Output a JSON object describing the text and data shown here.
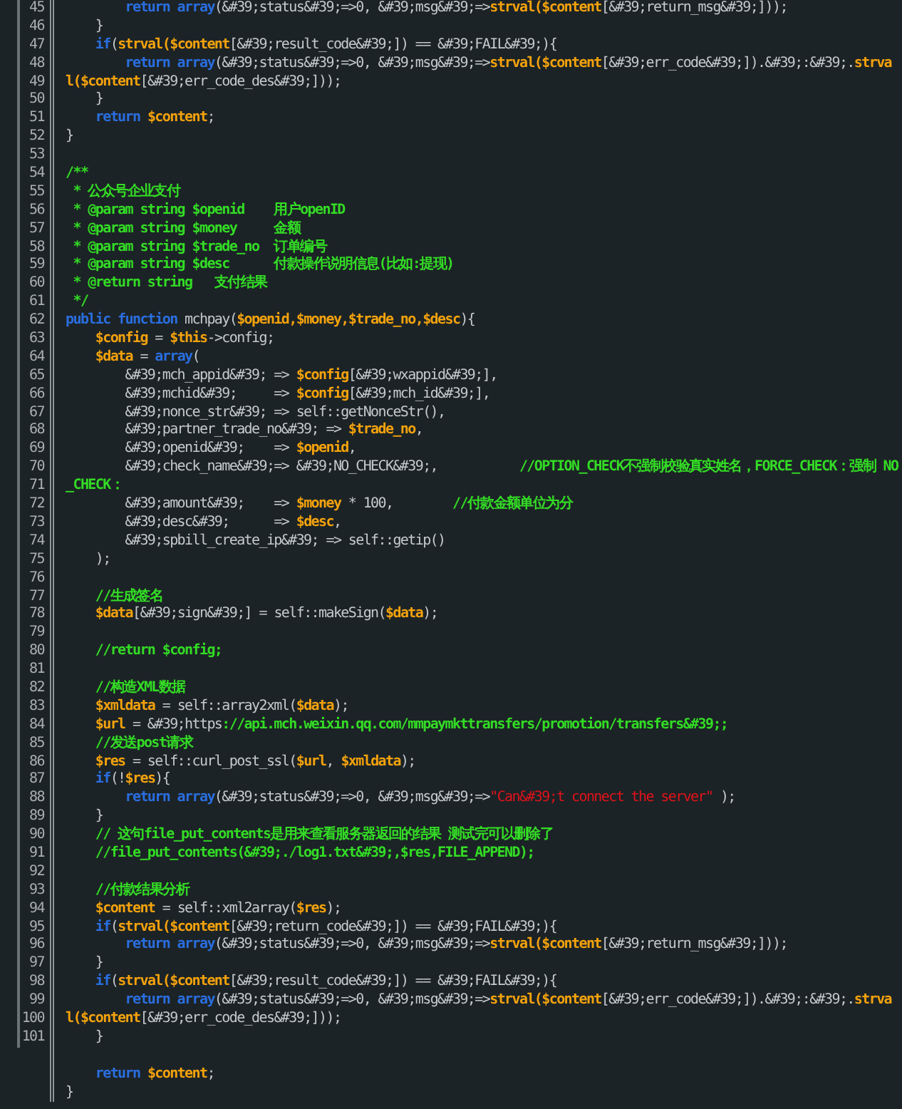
{
  "editor": {
    "lines": [
      {
        "number": "45",
        "tokens": [
          {
            "kind": "keyword",
            "text": "        return array"
          },
          {
            "kind": "plain",
            "text": "(&#39;status&#39;=>0, &#39;msg&#39;=>"
          },
          {
            "kind": "variable",
            "text": "strval($content"
          },
          {
            "kind": "plain",
            "text": "[&#39;return_msg&#39;]));"
          }
        ]
      },
      {
        "number": "46",
        "tokens": [
          {
            "kind": "plain",
            "text": "    }"
          }
        ]
      },
      {
        "number": "47",
        "tokens": [
          {
            "kind": "keyword",
            "text": "    if"
          },
          {
            "kind": "plain",
            "text": "("
          },
          {
            "kind": "variable",
            "text": "strval($content"
          },
          {
            "kind": "plain",
            "text": "[&#39;result_code&#39;]) == &#39;FAIL&#39;){"
          }
        ]
      },
      {
        "number": "48",
        "tokens": [
          {
            "kind": "keyword",
            "text": "        return array"
          },
          {
            "kind": "plain",
            "text": "(&#39;status&#39;=>0, &#39;msg&#39;=>"
          },
          {
            "kind": "variable",
            "text": "strval($content"
          },
          {
            "kind": "plain",
            "text": "[&#39;err_code&#39;]).&#39;:&#39;."
          },
          {
            "kind": "variable",
            "text": "strva"
          }
        ]
      },
      {
        "number": "49",
        "tokens": [
          {
            "kind": "variable",
            "text": "l($content"
          },
          {
            "kind": "plain",
            "text": "[&#39;err_code_des&#39;]));"
          }
        ]
      },
      {
        "number": "50",
        "tokens": [
          {
            "kind": "plain",
            "text": "    }"
          }
        ]
      },
      {
        "number": "51",
        "tokens": [
          {
            "kind": "keyword",
            "text": "    return"
          },
          {
            "kind": "variable",
            "text": " $content"
          },
          {
            "kind": "plain",
            "text": ";"
          }
        ]
      },
      {
        "number": "52",
        "tokens": [
          {
            "kind": "plain",
            "text": "}"
          }
        ]
      },
      {
        "number": "53"
      },
      {
        "number": "54",
        "tokens": [
          {
            "kind": "comment",
            "text": "/**"
          }
        ]
      },
      {
        "number": "55",
        "tokens": [
          {
            "kind": "comment",
            "text": " * 公众号企业支付"
          }
        ]
      },
      {
        "number": "56",
        "tokens": [
          {
            "kind": "comment",
            "text": " * @param string $openid    用户openID"
          }
        ]
      },
      {
        "number": "57",
        "tokens": [
          {
            "kind": "comment",
            "text": " * @param string $money     金额"
          }
        ]
      },
      {
        "number": "58",
        "tokens": [
          {
            "kind": "comment",
            "text": " * @param string $trade_no  订单编号"
          }
        ]
      },
      {
        "number": "59",
        "tokens": [
          {
            "kind": "comment",
            "text": " * @param string $desc      付款操作说明信息(比如:提现)"
          }
        ]
      },
      {
        "number": "60",
        "tokens": [
          {
            "kind": "comment",
            "text": " * @return string   支付结果"
          }
        ]
      },
      {
        "number": "61",
        "tokens": [
          {
            "kind": "comment",
            "text": " */"
          }
        ]
      },
      {
        "number": "62",
        "tokens": [
          {
            "kind": "keyword",
            "text": "public function"
          },
          {
            "kind": "plain",
            "text": " mchpay("
          },
          {
            "kind": "variable",
            "text": "$openid,$money,$trade_no,$desc"
          },
          {
            "kind": "plain",
            "text": "){"
          }
        ]
      },
      {
        "number": "63",
        "tokens": [
          {
            "kind": "variable",
            "text": "    $config"
          },
          {
            "kind": "plain",
            "text": " = "
          },
          {
            "kind": "variable",
            "text": "$this"
          },
          {
            "kind": "plain",
            "text": "->config;"
          }
        ]
      },
      {
        "number": "64",
        "tokens": [
          {
            "kind": "variable",
            "text": "    $data"
          },
          {
            "kind": "plain",
            "text": " = "
          },
          {
            "kind": "keyword",
            "text": "array"
          },
          {
            "kind": "plain",
            "text": "("
          }
        ]
      },
      {
        "number": "65",
        "tokens": [
          {
            "kind": "plain",
            "text": "        &#39;mch_appid&#39; => "
          },
          {
            "kind": "variable",
            "text": "$config"
          },
          {
            "kind": "plain",
            "text": "[&#39;wxappid&#39;],"
          }
        ]
      },
      {
        "number": "66",
        "tokens": [
          {
            "kind": "plain",
            "text": "        &#39;mchid&#39;     => "
          },
          {
            "kind": "variable",
            "text": "$config"
          },
          {
            "kind": "plain",
            "text": "[&#39;mch_id&#39;],"
          }
        ]
      },
      {
        "number": "67",
        "tokens": [
          {
            "kind": "plain",
            "text": "        &#39;nonce_str&#39; => self::getNonceStr(),"
          }
        ]
      },
      {
        "number": "68",
        "tokens": [
          {
            "kind": "plain",
            "text": "        &#39;partner_trade_no&#39; => "
          },
          {
            "kind": "variable",
            "text": "$trade_no"
          },
          {
            "kind": "plain",
            "text": ","
          }
        ]
      },
      {
        "number": "69",
        "tokens": [
          {
            "kind": "plain",
            "text": "        &#39;openid&#39;    => "
          },
          {
            "kind": "variable",
            "text": "$openid"
          },
          {
            "kind": "plain",
            "text": ","
          }
        ]
      },
      {
        "number": "70",
        "tokens": [
          {
            "kind": "plain",
            "text": "        &#39;check_name&#39;=> &#39;NO_CHECK&#39;,           "
          },
          {
            "kind": "comment",
            "text": "//OPTION_CHECK不强制校验真实姓名，FORCE_CHECK：强制 NO"
          }
        ]
      },
      {
        "number": "71",
        "tokens": [
          {
            "kind": "comment",
            "text": "_CHECK："
          }
        ]
      },
      {
        "number": "72",
        "tokens": [
          {
            "kind": "plain",
            "text": "        &#39;amount&#39;    => "
          },
          {
            "kind": "variable",
            "text": "$money"
          },
          {
            "kind": "plain",
            "text": " * 100,        "
          },
          {
            "kind": "comment",
            "text": "//付款金额单位为分"
          }
        ]
      },
      {
        "number": "73",
        "tokens": [
          {
            "kind": "plain",
            "text": "        &#39;desc&#39;      => "
          },
          {
            "kind": "variable",
            "text": "$desc"
          },
          {
            "kind": "plain",
            "text": ","
          }
        ]
      },
      {
        "number": "74",
        "tokens": [
          {
            "kind": "plain",
            "text": "        &#39;spbill_create_ip&#39; => self::getip()"
          }
        ]
      },
      {
        "number": "75",
        "tokens": [
          {
            "kind": "plain",
            "text": "    );"
          }
        ]
      },
      {
        "number": "76"
      },
      {
        "number": "77",
        "tokens": [
          {
            "kind": "comment",
            "text": "    //生成签名"
          }
        ]
      },
      {
        "number": "78",
        "tokens": [
          {
            "kind": "variable",
            "text": "    $data"
          },
          {
            "kind": "plain",
            "text": "[&#39;sign&#39;] = self::makeSign("
          },
          {
            "kind": "variable",
            "text": "$data"
          },
          {
            "kind": "plain",
            "text": ");"
          }
        ]
      },
      {
        "number": "79"
      },
      {
        "number": "80",
        "tokens": [
          {
            "kind": "comment",
            "text": "    //return $config;"
          }
        ]
      },
      {
        "number": "81"
      },
      {
        "number": "82",
        "tokens": [
          {
            "kind": "comment",
            "text": "    //构造XML数据"
          }
        ]
      },
      {
        "number": "83",
        "tokens": [
          {
            "kind": "variable",
            "text": "    $xmldata"
          },
          {
            "kind": "plain",
            "text": " = self::array2xml("
          },
          {
            "kind": "variable",
            "text": "$data"
          },
          {
            "kind": "plain",
            "text": ");"
          }
        ]
      },
      {
        "number": "84",
        "tokens": [
          {
            "kind": "variable",
            "text": "    $url"
          },
          {
            "kind": "plain",
            "text": " = &#39;https"
          },
          {
            "kind": "comment",
            "text": "://api.mch.weixin.qq.com/mmpaymkttransfers/promotion/transfers&#39;;"
          }
        ]
      },
      {
        "number": "85",
        "tokens": [
          {
            "kind": "comment",
            "text": "    //发送post请求"
          }
        ]
      },
      {
        "number": "86",
        "tokens": [
          {
            "kind": "variable",
            "text": "    $res"
          },
          {
            "kind": "plain",
            "text": " = self::curl_post_ssl("
          },
          {
            "kind": "variable",
            "text": "$url"
          },
          {
            "kind": "plain",
            "text": ", "
          },
          {
            "kind": "variable",
            "text": "$xmldata"
          },
          {
            "kind": "plain",
            "text": ");"
          }
        ]
      },
      {
        "number": "87",
        "tokens": [
          {
            "kind": "keyword",
            "text": "    if"
          },
          {
            "kind": "plain",
            "text": "(!"
          },
          {
            "kind": "variable",
            "text": "$res"
          },
          {
            "kind": "plain",
            "text": "){"
          }
        ]
      },
      {
        "number": "88",
        "tokens": [
          {
            "kind": "keyword",
            "text": "        return array"
          },
          {
            "kind": "plain",
            "text": "(&#39;status&#39;=>0, &#39;msg&#39;=>"
          },
          {
            "kind": "string",
            "text": "\"Can&#39;t connect the server\""
          },
          {
            "kind": "plain",
            "text": " );"
          }
        ]
      },
      {
        "number": "89",
        "tokens": [
          {
            "kind": "plain",
            "text": "    }"
          }
        ]
      },
      {
        "number": "90",
        "tokens": [
          {
            "kind": "comment",
            "text": "    // 这句file_put_contents是用来查看服务器返回的结果 测试完可以删除了"
          }
        ]
      },
      {
        "number": "91",
        "tokens": [
          {
            "kind": "comment",
            "text": "    //file_put_contents(&#39;./log1.txt&#39;,$res,FILE_APPEND);"
          }
        ]
      },
      {
        "number": "92"
      },
      {
        "number": "93",
        "tokens": [
          {
            "kind": "comment",
            "text": "    //付款结果分析"
          }
        ]
      },
      {
        "number": "94",
        "tokens": [
          {
            "kind": "variable",
            "text": "    $content"
          },
          {
            "kind": "plain",
            "text": " = self::xml2array("
          },
          {
            "kind": "variable",
            "text": "$res"
          },
          {
            "kind": "plain",
            "text": ");"
          }
        ]
      },
      {
        "number": "95",
        "tokens": [
          {
            "kind": "keyword",
            "text": "    if"
          },
          {
            "kind": "plain",
            "text": "("
          },
          {
            "kind": "variable",
            "text": "strval($content"
          },
          {
            "kind": "plain",
            "text": "[&#39;return_code&#39;]) == &#39;FAIL&#39;){"
          }
        ]
      },
      {
        "number": "96",
        "tokens": [
          {
            "kind": "keyword",
            "text": "        return array"
          },
          {
            "kind": "plain",
            "text": "(&#39;status&#39;=>0, &#39;msg&#39;=>"
          },
          {
            "kind": "variable",
            "text": "strval($content"
          },
          {
            "kind": "plain",
            "text": "[&#39;return_msg&#39;]));"
          }
        ]
      },
      {
        "number": "97",
        "tokens": [
          {
            "kind": "plain",
            "text": "    }"
          }
        ]
      },
      {
        "number": "98",
        "tokens": [
          {
            "kind": "keyword",
            "text": "    if"
          },
          {
            "kind": "plain",
            "text": "("
          },
          {
            "kind": "variable",
            "text": "strval($content"
          },
          {
            "kind": "plain",
            "text": "[&#39;result_code&#39;]) == &#39;FAIL&#39;){"
          }
        ]
      },
      {
        "number": "99",
        "tokens": [
          {
            "kind": "keyword",
            "text": "        return array"
          },
          {
            "kind": "plain",
            "text": "(&#39;status&#39;=>0, &#39;msg&#39;=>"
          },
          {
            "kind": "variable",
            "text": "strval($content"
          },
          {
            "kind": "plain",
            "text": "[&#39;err_code&#39;]).&#39;:&#39;."
          },
          {
            "kind": "variable",
            "text": "strva"
          }
        ]
      },
      {
        "number": "100",
        "tokens": [
          {
            "kind": "variable",
            "text": "l($content"
          },
          {
            "kind": "plain",
            "text": "[&#39;err_code_des&#39;]));"
          }
        ]
      },
      {
        "number": "101",
        "tokens": [
          {
            "kind": "plain",
            "text": "    }"
          }
        ]
      },
      {
        "blank": true
      },
      {
        "tokens": [
          {
            "kind": "keyword",
            "text": "    return"
          },
          {
            "kind": "variable",
            "text": " $content"
          },
          {
            "kind": "plain",
            "text": ";"
          }
        ]
      },
      {
        "tokens": [
          {
            "kind": "plain",
            "text": "}"
          }
        ]
      }
    ]
  }
}
